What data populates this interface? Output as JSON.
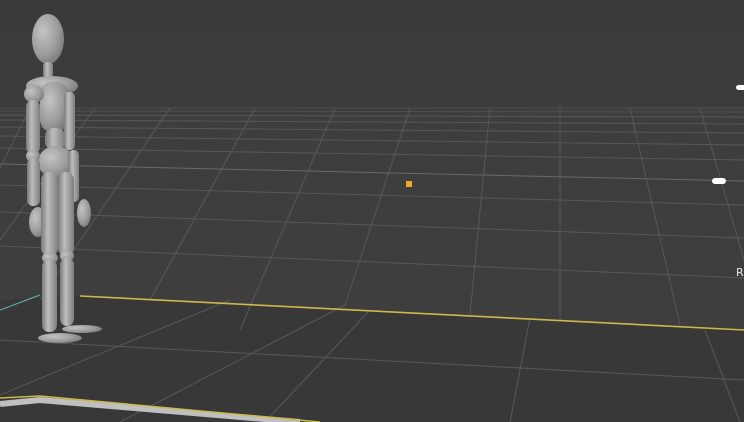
{
  "viewport": {
    "background_color": "#3d3d3d",
    "floor_color": "#393939",
    "grid_color": "#555555",
    "floor_edge_color": "#d4c04a",
    "axis_color": "#5fb8b0",
    "origin_color": "#f5a623",
    "handle_color": "#ffffff",
    "mannequin_color": "#9e9e9e"
  },
  "objects": [
    {
      "name": "mannequin",
      "kind": "armature-figure"
    },
    {
      "name": "origin-point",
      "kind": "object-origin"
    },
    {
      "name": "gizmo-handle-top",
      "kind": "handle"
    },
    {
      "name": "gizmo-handle-mid",
      "kind": "handle"
    }
  ],
  "edge_label": "R"
}
